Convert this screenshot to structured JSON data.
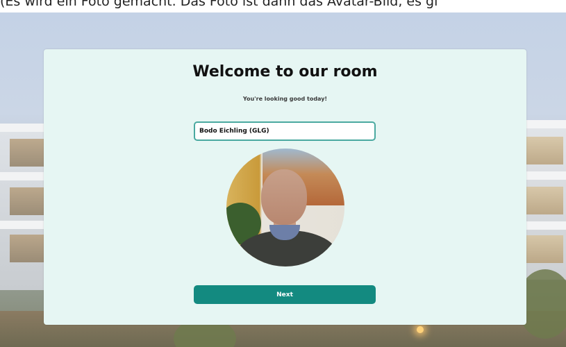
{
  "caption": {
    "text": "(Es wird ein Foto gemacht. Das Foto ist dann das Avatar-Bild, es gi"
  },
  "dialog": {
    "title": "Welcome to our room",
    "subtitle": "You're looking good today!",
    "name_input_value": "Bodo Eichling (GLG)",
    "next_label": "Next"
  },
  "colors": {
    "card_background": "#e6f6f3",
    "accent": "#138a80",
    "input_border": "#4aa9a0"
  },
  "icons": {
    "avatar": "user-photo"
  }
}
